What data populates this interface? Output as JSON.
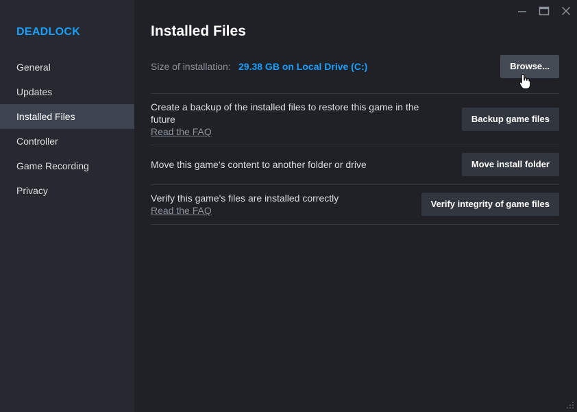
{
  "game": {
    "title": "DEADLOCK"
  },
  "sidebar": {
    "items": [
      {
        "label": "General",
        "active": false
      },
      {
        "label": "Updates",
        "active": false
      },
      {
        "label": "Installed Files",
        "active": true
      },
      {
        "label": "Controller",
        "active": false
      },
      {
        "label": "Game Recording",
        "active": false
      },
      {
        "label": "Privacy",
        "active": false
      }
    ]
  },
  "window_controls": {
    "minimize": "minimize-icon",
    "maximize": "maximize-icon",
    "close": "close-icon"
  },
  "main": {
    "title": "Installed Files",
    "size": {
      "label": "Size of installation:",
      "value": "29.38 GB on Local Drive (C:)",
      "browse_label": "Browse..."
    },
    "options": [
      {
        "text_line1": "Create a backup of the installed files to restore this game in the",
        "text_line2": "future",
        "link": "Read the FAQ",
        "button": "Backup game files"
      },
      {
        "text_line1": "Move this game's content to another folder or drive",
        "button": "Move install folder"
      },
      {
        "text_line1": "Verify this game's files are installed correctly",
        "link": "Read the FAQ",
        "button": "Verify integrity of game files"
      }
    ]
  },
  "colors": {
    "accent": "#1a9fff",
    "sidebar_bg": "#26292f",
    "main_bg": "#1f2126",
    "active_item": "#3d4450",
    "button_bg": "#32363f"
  }
}
